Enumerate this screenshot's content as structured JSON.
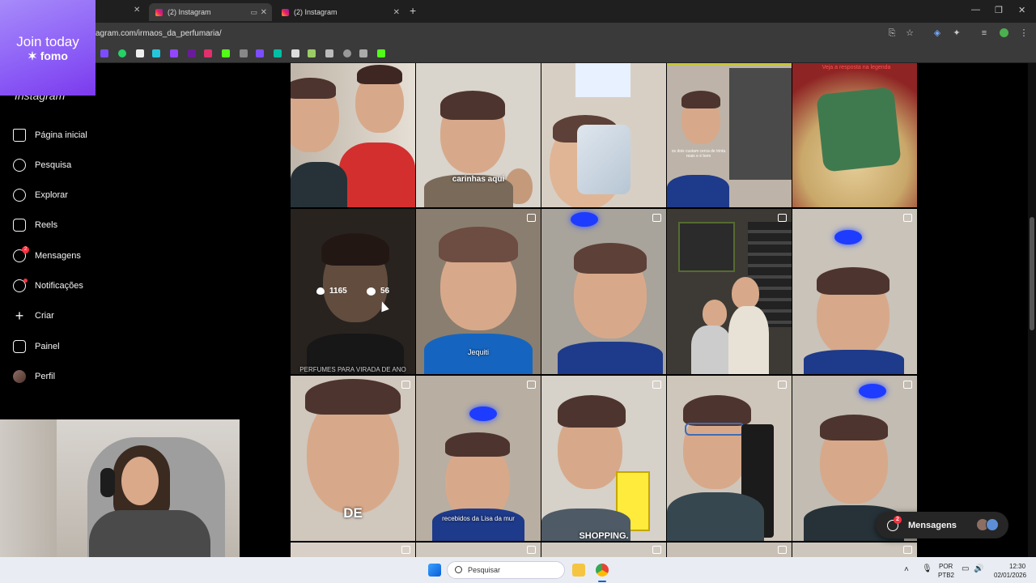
{
  "browser": {
    "tabs": [
      {
        "title": "(2) Instagram",
        "active": true
      },
      {
        "title": "(2) Instagram",
        "active": false
      }
    ],
    "new_tab": "+",
    "url": "agram.com/irmaos_da_perfumaria/"
  },
  "fomo_ad": {
    "line1": "Join today",
    "line2": "✶ fomo"
  },
  "instagram": {
    "logo_partial": "Instagram",
    "nav": [
      {
        "label": "Página inicial",
        "icon": "home-icon"
      },
      {
        "label": "Pesquisa",
        "icon": "search-icon"
      },
      {
        "label": "Explorar",
        "icon": "compass-icon"
      },
      {
        "label": "Reels",
        "icon": "reels-icon"
      },
      {
        "label": "Mensagens",
        "icon": "messenger-icon",
        "badge": "2"
      },
      {
        "label": "Notificações",
        "icon": "heart-icon"
      },
      {
        "label": "Criar",
        "icon": "plus-icon"
      },
      {
        "label": "Painel",
        "icon": "chart-icon"
      },
      {
        "label": "Perfil",
        "icon": "avatar"
      }
    ],
    "grid": {
      "hovered_post": {
        "likes": "1165",
        "comments": "56",
        "caption": "PERFUMES PARA VIRADA DE ANO"
      },
      "captions": {
        "r1c2": "carinhas aqui",
        "r1c4": "os dois custam cerca de trinta reais e é bem",
        "r1c5": "Veja a resposta na legenda",
        "r2c2": "Jequiti",
        "r3c1": "DE",
        "r3c2": "recebidos da Lisa da mur",
        "r3c3": "SHOPPING."
      }
    },
    "messages_pill": {
      "label": "Mensagens",
      "badge": "2"
    }
  },
  "taskbar": {
    "search_placeholder": "Pesquisar",
    "lang1": "POR",
    "lang2": "PTB2",
    "time": "12:30",
    "date": "02/01/2026"
  }
}
